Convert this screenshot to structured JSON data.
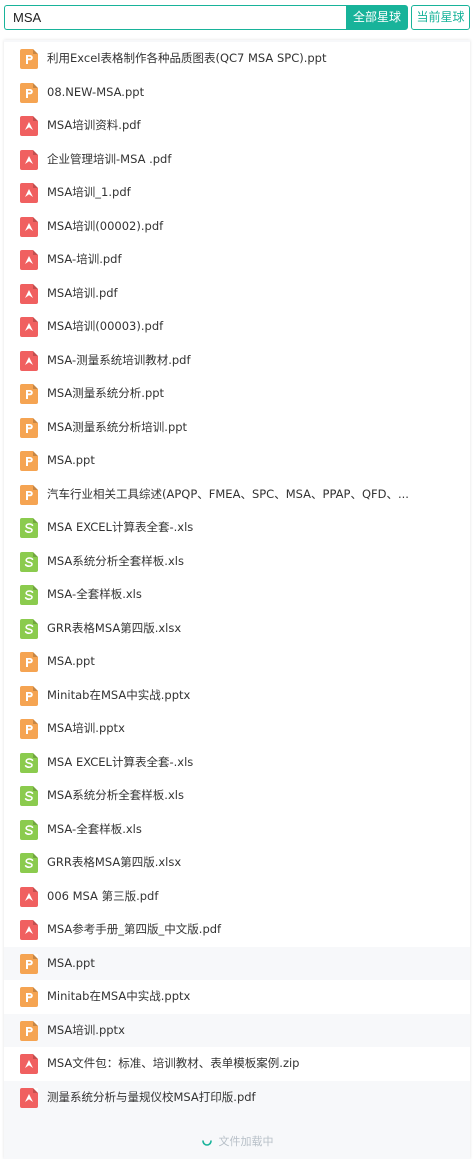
{
  "search": {
    "value": "MSA"
  },
  "buttons": {
    "all_label": "全部星球",
    "current_label": "当前星球"
  },
  "colors": {
    "accent": "#18b39a",
    "ppt": "#f5a452",
    "pdf": "#f06060",
    "xls": "#8bcb4e"
  },
  "files": [
    {
      "type": "ppt",
      "title": "利用Excel表格制作各种品质图表(QC7 MSA SPC).ppt"
    },
    {
      "type": "ppt",
      "title": "08.NEW-MSA.ppt"
    },
    {
      "type": "pdf",
      "title": "MSA培训资料.pdf"
    },
    {
      "type": "pdf",
      "title": "企业管理培训-MSA .pdf"
    },
    {
      "type": "pdf",
      "title": "MSA培训_1.pdf"
    },
    {
      "type": "pdf",
      "title": "MSA培训(00002).pdf"
    },
    {
      "type": "pdf",
      "title": "MSA-培训.pdf"
    },
    {
      "type": "pdf",
      "title": "MSA培训.pdf"
    },
    {
      "type": "pdf",
      "title": "MSA培训(00003).pdf"
    },
    {
      "type": "pdf",
      "title": "MSA-测量系统培训教材.pdf"
    },
    {
      "type": "ppt",
      "title": "MSA测量系统分析.ppt"
    },
    {
      "type": "ppt",
      "title": "MSA测量系统分析培训.ppt"
    },
    {
      "type": "ppt",
      "title": "MSA.ppt"
    },
    {
      "type": "ppt",
      "title": "汽车行业相关工具综述(APQP、FMEA、SPC、MSA、PPAP、QFD、..."
    },
    {
      "type": "xls",
      "title": "MSA EXCEL计算表全套-.xls"
    },
    {
      "type": "xls",
      "title": "MSA系统分析全套样板.xls"
    },
    {
      "type": "xls",
      "title": "MSA-全套样板.xls"
    },
    {
      "type": "xls",
      "title": "GRR表格MSA第四版.xlsx"
    },
    {
      "type": "ppt",
      "title": "MSA.ppt"
    },
    {
      "type": "ppt",
      "title": "Minitab在MSA中实战.pptx"
    },
    {
      "type": "ppt",
      "title": "MSA培训.pptx"
    },
    {
      "type": "xls",
      "title": "MSA EXCEL计算表全套-.xls"
    },
    {
      "type": "xls",
      "title": "MSA系统分析全套样板.xls"
    },
    {
      "type": "xls",
      "title": "MSA-全套样板.xls"
    },
    {
      "type": "xls",
      "title": "GRR表格MSA第四版.xlsx"
    },
    {
      "type": "pdf",
      "title": "006 MSA 第三版.pdf"
    },
    {
      "type": "pdf",
      "title": "MSA参考手册_第四版_中文版.pdf"
    },
    {
      "type": "ppt",
      "title": "MSA.ppt"
    },
    {
      "type": "ppt",
      "title": "Minitab在MSA中实战.pptx"
    },
    {
      "type": "ppt",
      "title": "MSA培训.pptx"
    },
    {
      "type": "pdf",
      "title": "MSA文件包：标准、培训教材、表单模板案例.zip"
    },
    {
      "type": "pdf",
      "title": "测量系统分析与量规仪校MSA打印版.pdf"
    }
  ],
  "footer": {
    "loading_text": "文件加载中"
  }
}
